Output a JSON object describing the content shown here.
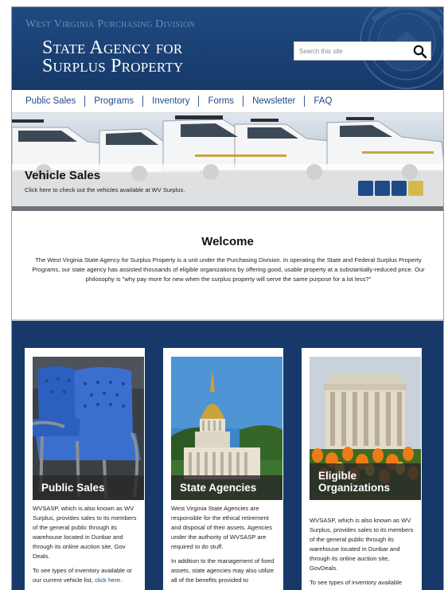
{
  "header": {
    "division": "West Virginia Purchasing Division",
    "title_line1": "State Agency for",
    "title_line2": "Surplus Property",
    "search_placeholder": "Search this site"
  },
  "nav": {
    "items": [
      "Public Sales",
      "Programs",
      "Inventory",
      "Forms",
      "Newsletter",
      "FAQ"
    ]
  },
  "hero": {
    "title": "Vehicle Sales",
    "subtitle": "Click here to check out the vehicles available at WV Surplus.",
    "slides": 4,
    "active_slide": 4
  },
  "welcome": {
    "title": "Welcome",
    "text": "The West Virginia State Agency for Surplus Property is a unit under the Purchasing Division. In operating the State and Federal Surplus Property Programs, our state agency has assisted thousands of eligible organizations by offering good, usable property at a substantially-reduced price. Our philosophy is \"why pay more for new when the surplus property will serve the same purpose for a lot less?\""
  },
  "cards": [
    {
      "label": "Public Sales",
      "p1": "WVSASP, which is also known as WV Surplus, provides sales to its members of the general public through its warehouse located in Dunbar and through its online auction site, Gov Deals.",
      "p2": "To see types of inventory available or our current vehicle list, ",
      "p2_link": "click here."
    },
    {
      "label": "State Agencies",
      "p1": "West Virginia State Agencies are responsible for the ethical retirement and disposal of their assets. Agencies under the authority of WVSASP are required to do stuff.",
      "p2": "In addition to the management of fixed assets, state agencies may also utilize all of the benefits provided to",
      "p2_link": ""
    },
    {
      "label_line1": "Eligible",
      "label_line2": "Organizations",
      "p1": "WVSASP, which is also known as WV Surplus, provides sales to its members of the general public through its warehouse located in Dunbar and through its online auction site, GovDeals.",
      "p2": "To see types of inventory available",
      "p2_link": ""
    }
  ],
  "colors": {
    "brand_blue": "#17396a",
    "nav_text": "#1d4b88",
    "accent_gold": "#d5b94d"
  }
}
